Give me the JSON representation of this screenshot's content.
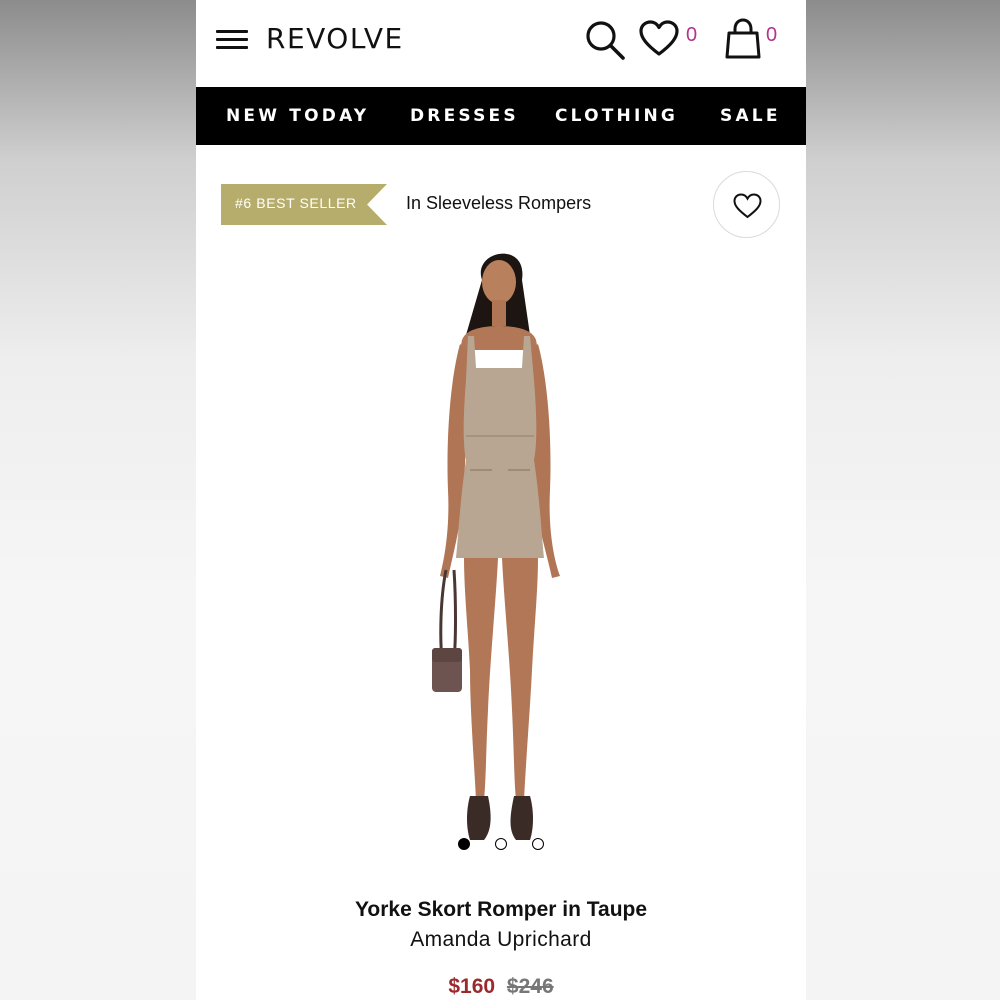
{
  "header": {
    "logo": "REVOLVE",
    "wishlist_count": "0",
    "bag_count": "0",
    "icons": [
      "menu-icon",
      "search-icon",
      "heart-icon",
      "shopping-bag-icon"
    ]
  },
  "nav": {
    "items": [
      {
        "label": "NEW TODAY"
      },
      {
        "label": "DRESSES"
      },
      {
        "label": "CLOTHING"
      },
      {
        "label": "SALE"
      }
    ]
  },
  "badge": {
    "label": "#6 BEST SELLER",
    "category": "In Sleeveless Rompers",
    "color": "#b6ad6c"
  },
  "carousel": {
    "total": 3,
    "active": 1
  },
  "product": {
    "name": "Yorke Skort Romper in Taupe",
    "brand": "Amanda Uprichard",
    "sale_price": "$160",
    "original_price": "$246",
    "sale_color": "#9b2a2d"
  },
  "colors": {
    "accent_count": "#b0358c",
    "navbar_bg": "#000000"
  }
}
